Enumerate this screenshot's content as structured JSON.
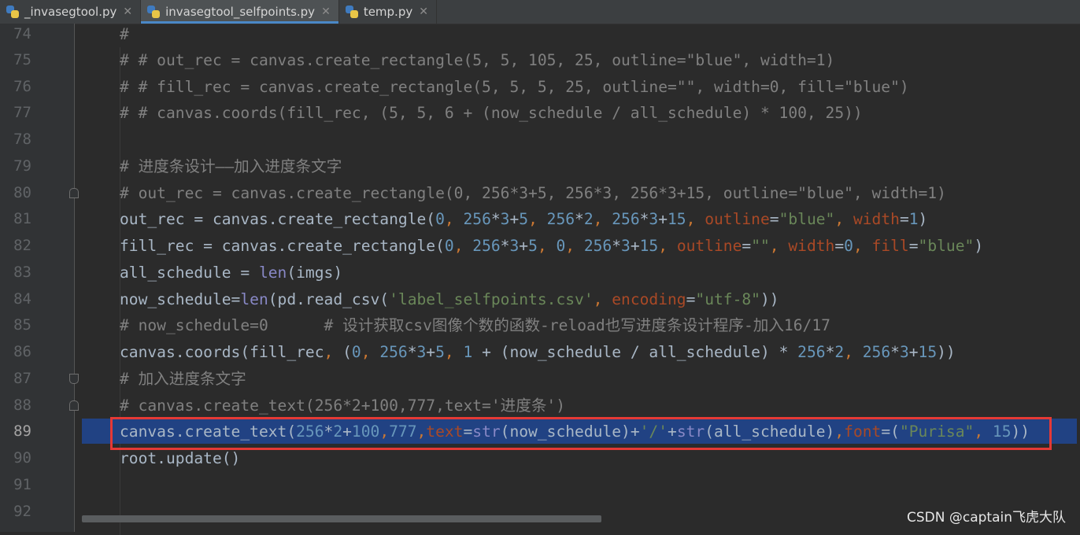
{
  "tabs": [
    {
      "label": "_invasegtool.py",
      "active": false
    },
    {
      "label": "invasegtool_selfpoints.py",
      "active": true
    },
    {
      "label": "temp.py",
      "active": false
    }
  ],
  "lines": [
    {
      "n": "74",
      "code": "#"
    },
    {
      "n": "75",
      "code": "# # out_rec = canvas.create_rectangle(5, 5, 105, 25, outline=\"blue\", width=1)"
    },
    {
      "n": "76",
      "code": "# # fill_rec = canvas.create_rectangle(5, 5, 5, 25, outline=\"\", width=0, fill=\"blue\")"
    },
    {
      "n": "77",
      "code": "# # canvas.coords(fill_rec, (5, 5, 6 + (now_schedule / all_schedule) * 100, 25))"
    },
    {
      "n": "78",
      "code": ""
    },
    {
      "n": "79",
      "code": "# 进度条设计——加入进度条文字"
    },
    {
      "n": "80",
      "code": "# out_rec = canvas.create_rectangle(0, 256*3+5, 256*3, 256*3+15, outline=\"blue\", width=1)"
    },
    {
      "n": "81",
      "code": "out_rec = canvas.create_rectangle(0, 256*3+5, 256*2, 256*3+15, outline=\"blue\", width=1)"
    },
    {
      "n": "82",
      "code": "fill_rec = canvas.create_rectangle(0, 256*3+5, 0, 256*3+15, outline=\"\", width=0, fill=\"blue\")"
    },
    {
      "n": "83",
      "code": "all_schedule = len(imgs)"
    },
    {
      "n": "84",
      "code": "now_schedule=len(pd.read_csv('label_selfpoints.csv', encoding=\"utf-8\"))"
    },
    {
      "n": "85",
      "code": "# now_schedule=0      # 设计获取csv图像个数的函数-reload也写进度条设计程序-加入16/17"
    },
    {
      "n": "86",
      "code": "canvas.coords(fill_rec, (0, 256*3+5, 1 + (now_schedule / all_schedule) * 256*2, 256*3+15))"
    },
    {
      "n": "87",
      "code": "# 加入进度条文字"
    },
    {
      "n": "88",
      "code": "# canvas.create_text(256*2+100,777,text='进度条')"
    },
    {
      "n": "89",
      "code": "canvas.create_text(256*2+100,777,text=str(now_schedule)+'/'+str(all_schedule),font=(\"Purisa\", 15))"
    },
    {
      "n": "90",
      "code": "root.update()"
    },
    {
      "n": "91",
      "code": ""
    },
    {
      "n": "92",
      "code": ""
    }
  ],
  "current_line": "89",
  "watermark": "CSDN @captain飞虎大队",
  "colors": {
    "background": "#2b2b2b",
    "gutter": "#313335",
    "current_line_highlight": "#214283",
    "annotation_box": "#e53935",
    "active_tab_underline": "#4a88c7"
  },
  "icons": [
    "python-file-icon",
    "close-icon"
  ]
}
